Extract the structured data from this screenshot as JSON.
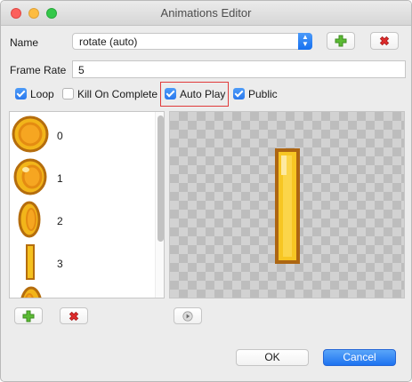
{
  "window": {
    "title": "Animations Editor"
  },
  "name_row": {
    "label": "Name",
    "selected": "rotate (auto)"
  },
  "frame_rate": {
    "label": "Frame Rate",
    "value": "5"
  },
  "options": [
    {
      "label": "Loop",
      "checked": true
    },
    {
      "label": "Kill On Complete",
      "checked": false
    },
    {
      "label": "Auto Play",
      "checked": true
    },
    {
      "label": "Public",
      "checked": true
    }
  ],
  "frames": [
    {
      "index": "0"
    },
    {
      "index": "1"
    },
    {
      "index": "2"
    },
    {
      "index": "3"
    }
  ],
  "footer": {
    "ok_label": "OK",
    "cancel_label": "Cancel"
  },
  "icons": {
    "add": "plus-icon",
    "delete": "x-icon",
    "play": "play-icon",
    "add_color": "#56b72f",
    "delete_color": "#d6262a"
  }
}
